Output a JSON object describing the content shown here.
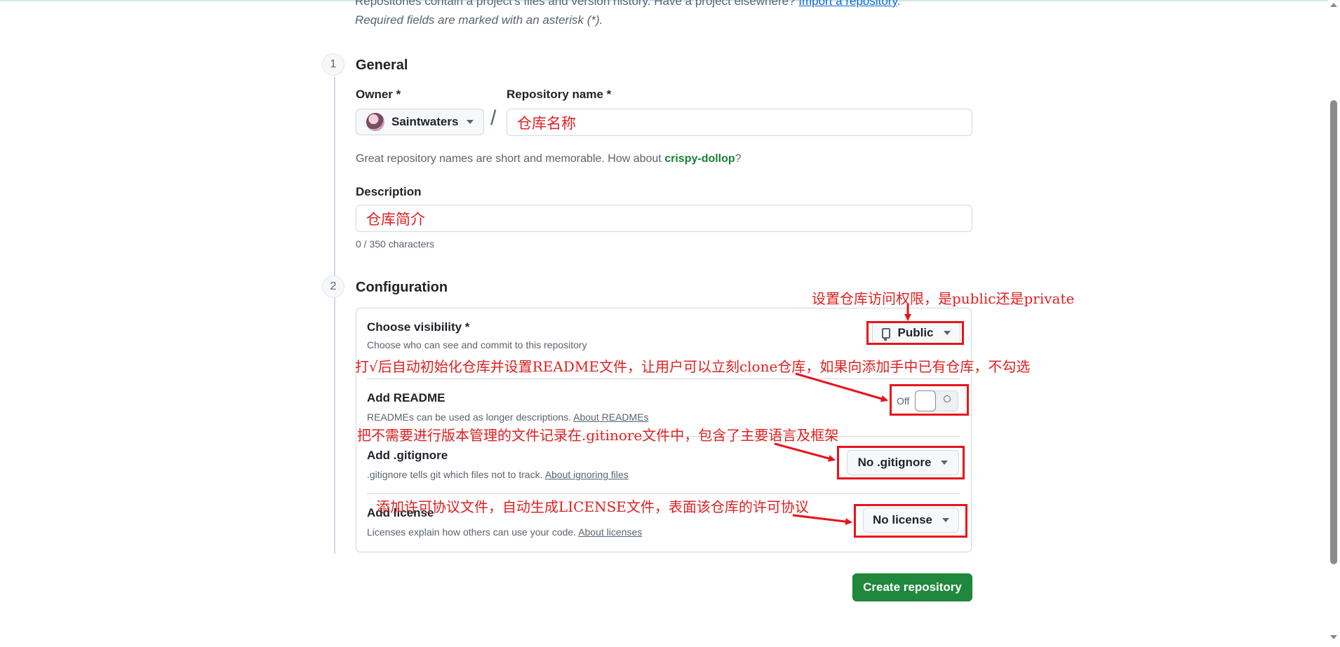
{
  "intro": {
    "line1_prefix": "Repositories contain a project's files and version history. Have a project elsewhere? ",
    "import_link": "Import a repository",
    "line1_suffix": ".",
    "line2": "Required fields are marked with an asterisk (*)."
  },
  "general": {
    "step": "1",
    "title": "General",
    "owner_label": "Owner *",
    "owner_value": "Saintwaters",
    "slash": "/",
    "repo_name_label": "Repository name *",
    "repo_name_value": "仓库名称",
    "name_hint_prefix": "Great repository names are short and memorable. How about ",
    "name_hint_suggestion": "crispy-dollop",
    "name_hint_suffix": "?",
    "description_label": "Description",
    "description_value": "仓库简介",
    "char_count": "0 / 350 characters"
  },
  "configuration": {
    "step": "2",
    "title": "Configuration",
    "visibility": {
      "title": "Choose visibility *",
      "desc": "Choose who can see and commit to this repository",
      "value": "Public",
      "icon": "repo-icon"
    },
    "readme": {
      "title": "Add README",
      "desc": "READMEs can be used as longer descriptions. ",
      "link": "About READMEs",
      "toggle_label": "Off",
      "toggle_state": "off"
    },
    "gitignore": {
      "title": "Add .gitignore",
      "desc": ".gitignore tells git which files not to track. ",
      "link": "About ignoring files",
      "value": "No .gitignore"
    },
    "license": {
      "title": "Add license",
      "desc": "Licenses explain how others can use your code. ",
      "link": "About licenses",
      "value": "No license"
    }
  },
  "create_button": "Create repository",
  "annotations": {
    "visibility_note": "设置仓库访问权限，是public还是private",
    "readme_note": "打√后自动初始化仓库并设置README文件，让用户可以立刻clone仓库，如果向添加手中已有仓库，不勾选",
    "gitignore_note": "把不需要进行版本管理的文件记录在.gitinore文件中，包含了主要语言及框架",
    "license_note": "添加许可协议文件，自动生成LICENSE文件，表面该仓库的许可协议"
  },
  "colors": {
    "annotation_red": "#e8131b",
    "primary_green": "#1f883d",
    "link_blue": "#0969da",
    "suggestion_green": "#1a7f37"
  }
}
